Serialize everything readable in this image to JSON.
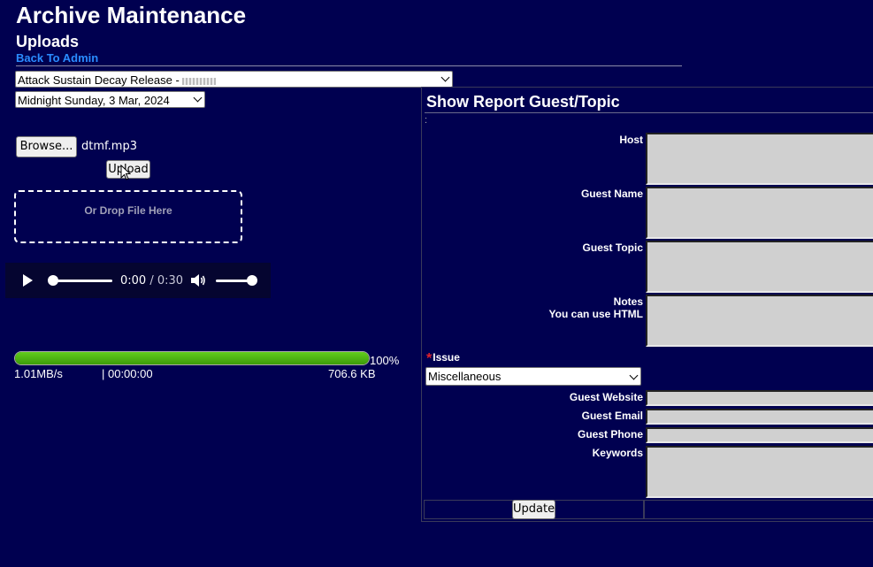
{
  "header": {
    "title": "Archive Maintenance",
    "subtitle": "Uploads",
    "back_link": "Back To Admin"
  },
  "show_select": {
    "value": "Attack Sustain Decay Release -"
  },
  "date_select": {
    "value": "Midnight Sunday, 3 Mar, 2024"
  },
  "upload": {
    "browse_label": "Browse...",
    "file_name": "dtmf.mp3",
    "upload_label": "Upload",
    "drop_text": "Or Drop File Here"
  },
  "player": {
    "current_time": "0:00",
    "separator": " / ",
    "duration": "0:30",
    "seek_fraction": 0,
    "volume_fraction": 1.0
  },
  "progress": {
    "percent_value": 100,
    "percent": "100%",
    "speed": "1.01MB/s",
    "elapsed": "| 00:00:00",
    "size": "706.6 KB",
    "colors": {
      "fill": "#4caf14",
      "track": "#e0e0e0"
    }
  },
  "report": {
    "title": "Show Report Guest/Topic",
    "colon": ":",
    "host_label": "Host",
    "guest_name_label": "Guest Name",
    "guest_topic_label": "Guest Topic",
    "notes_label": "Notes",
    "notes_hint": "You can use HTML",
    "issue_label": "Issue",
    "issue_required": "*",
    "issue_value": "Miscellaneous",
    "guest_website_label": "Guest Website",
    "guest_email_label": "Guest Email",
    "guest_phone_label": "Guest Phone",
    "keywords_label": "Keywords",
    "update_label": "Update"
  },
  "icons": [
    "play-icon",
    "volume-icon",
    "chevron-down-icon",
    "mouse-cursor-icon"
  ],
  "colors": {
    "background": "#000050",
    "link": "#2a8cff",
    "required": "#e0222a"
  }
}
